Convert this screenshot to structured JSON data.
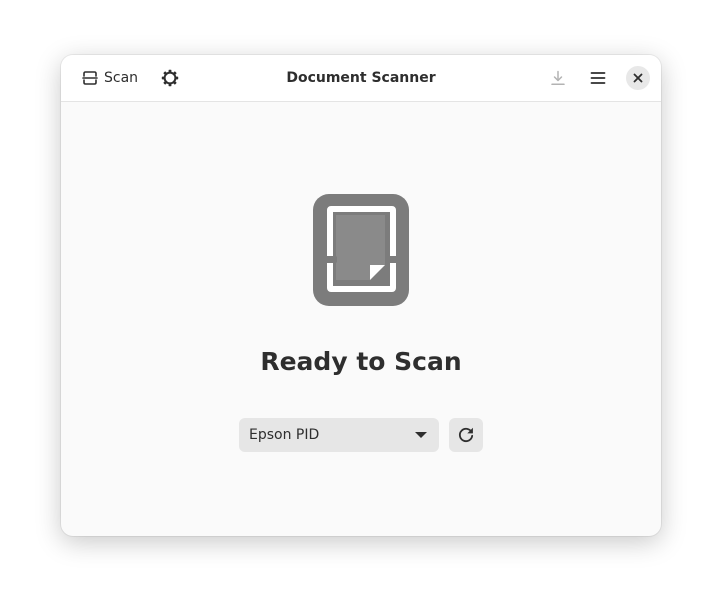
{
  "window": {
    "title": "Document Scanner"
  },
  "headerbar": {
    "scan_label": "Scan",
    "prefs_icon": "gear-icon",
    "save_icon": "download-icon",
    "menu_icon": "hamburger-menu-icon",
    "close_icon": "close-icon"
  },
  "main": {
    "status_icon": "scanner-document-icon",
    "status_title": "Ready to Scan",
    "device_selector": {
      "selected": "Epson PID"
    },
    "refresh_icon": "refresh-icon"
  },
  "colors": {
    "window_bg": "#fafafa",
    "headerbar_bg": "#ffffff",
    "text": "#2e2e2e",
    "icon_gray": "#7c7c7c",
    "button_bg": "#e6e6e6",
    "disabled_icon": "#b3b3b3"
  }
}
